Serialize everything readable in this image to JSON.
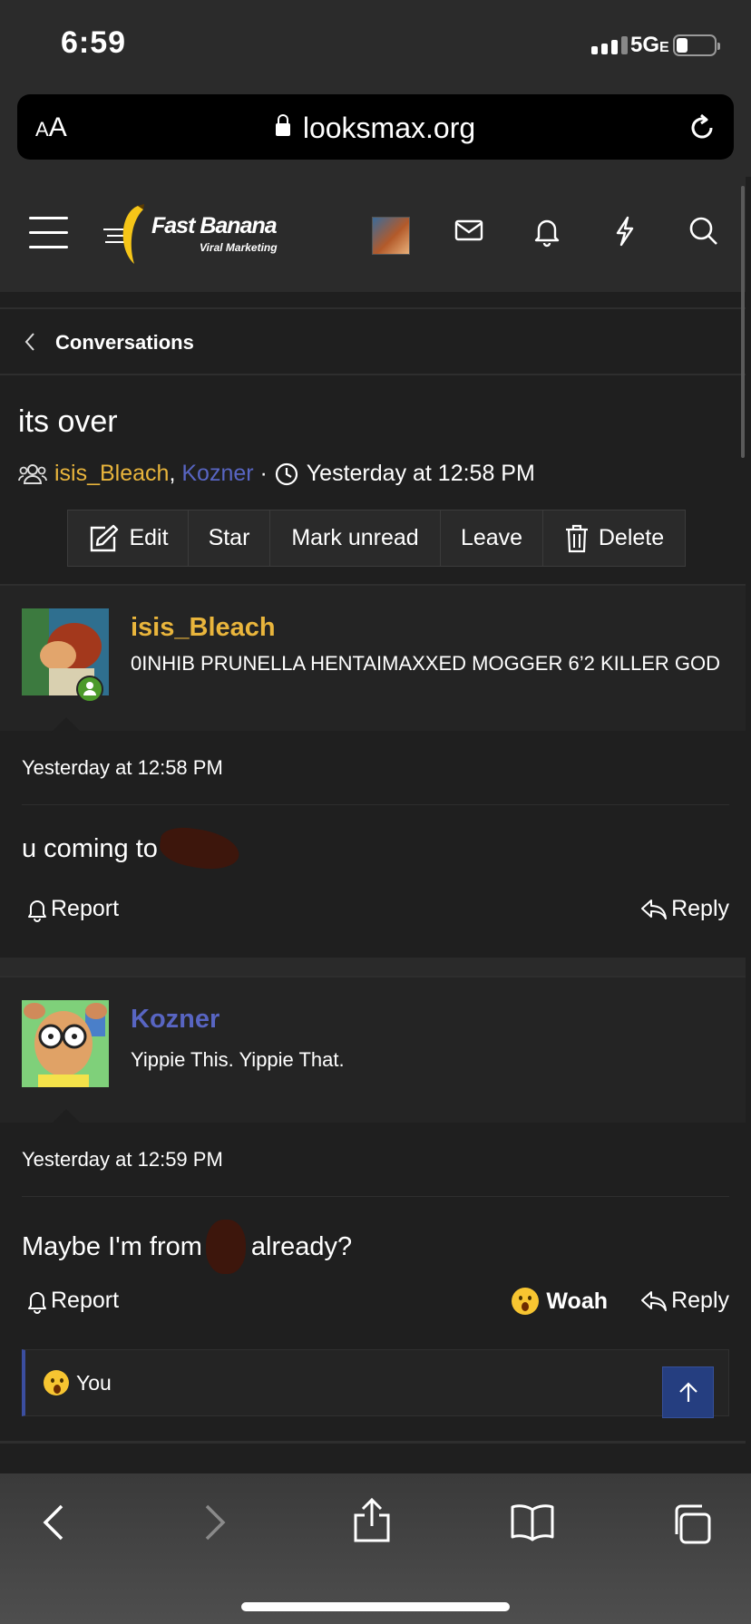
{
  "status_bar": {
    "time": "6:59",
    "network": "5G",
    "network_suffix": "E",
    "battery_level": 0.3
  },
  "browser": {
    "text_size_label": "AA",
    "url": "looksmax.org"
  },
  "site_header": {
    "logo_title": "Fast Banana",
    "logo_subtitle": "Viral Marketing",
    "icons": [
      "menu-icon",
      "avatar",
      "envelope-icon",
      "bell-icon",
      "bolt-icon",
      "search-icon"
    ]
  },
  "breadcrumb": {
    "label": "Conversations"
  },
  "conversation": {
    "title": "its over",
    "participants": [
      "isis_Bleach",
      "Kozner"
    ],
    "separator": ", ",
    "dot": " · ",
    "started": "Yesterday at 12:58 PM"
  },
  "actions": {
    "edit": "Edit",
    "star": "Star",
    "mark_unread": "Mark unread",
    "leave": "Leave",
    "delete": "Delete"
  },
  "messages": [
    {
      "username": "isis_Bleach",
      "username_color": "#e9b53c",
      "user_title": "0INHIB PRUNELLA HENTAIMAXXED MOGGER 6’2 KILLER GOD",
      "date": "Yesterday at 12:58 PM",
      "body_before": "u coming to",
      "body_after": "",
      "report": "Report",
      "reply": "Reply"
    },
    {
      "username": "Kozner",
      "username_color": "#5865c2",
      "user_title": "Yippie This. Yippie That.",
      "date": "Yesterday at 12:59 PM",
      "body_before": "Maybe I'm from",
      "body_after": "already?",
      "report": "Report",
      "reaction": "Woah",
      "reply": "Reply"
    }
  ],
  "reactions_summary": {
    "who": "You"
  },
  "colors": {
    "background": "#1f1f1f",
    "header": "#2b2b2b",
    "accent_blue": "#253e80",
    "username_yellow": "#e9b53c",
    "username_blue": "#5865c2"
  }
}
